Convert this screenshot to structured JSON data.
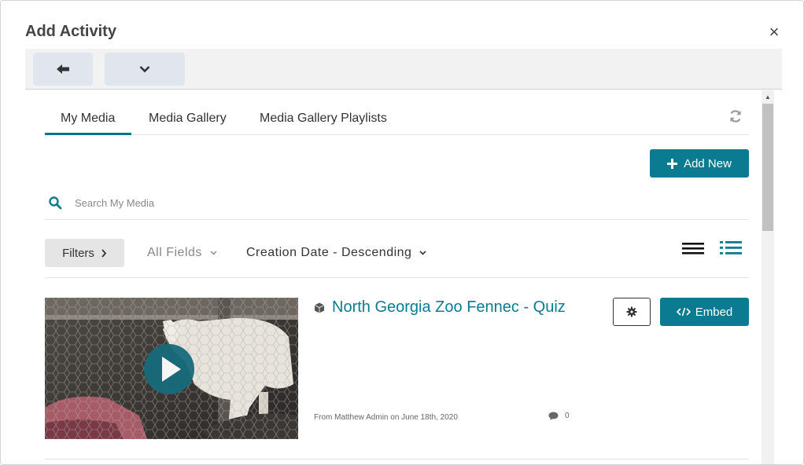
{
  "dialog": {
    "title": "Add Activity",
    "close_label": "×"
  },
  "toolbar": {
    "back_icon": "arrow-left-icon",
    "menu_icon": "chevron-down-icon"
  },
  "tabs": [
    {
      "label": "My Media",
      "active": true
    },
    {
      "label": "Media Gallery",
      "active": false
    },
    {
      "label": "Media Gallery Playlists",
      "active": false
    }
  ],
  "actions": {
    "add_new_label": "Add New"
  },
  "search": {
    "placeholder": "Search My Media",
    "value": ""
  },
  "filters": {
    "filters_label": "Filters",
    "field_selected": "All Fields",
    "sort_selected": "Creation Date - Descending"
  },
  "entries": [
    {
      "title": "North Georgia Zoo Fennec - Quiz",
      "meta": "From Matthew Admin on June 18th, 2020",
      "comments": "0",
      "embed_label": "Embed"
    }
  ],
  "colors": {
    "accent": "#0b7b91",
    "tab_underline": "#00768c"
  }
}
